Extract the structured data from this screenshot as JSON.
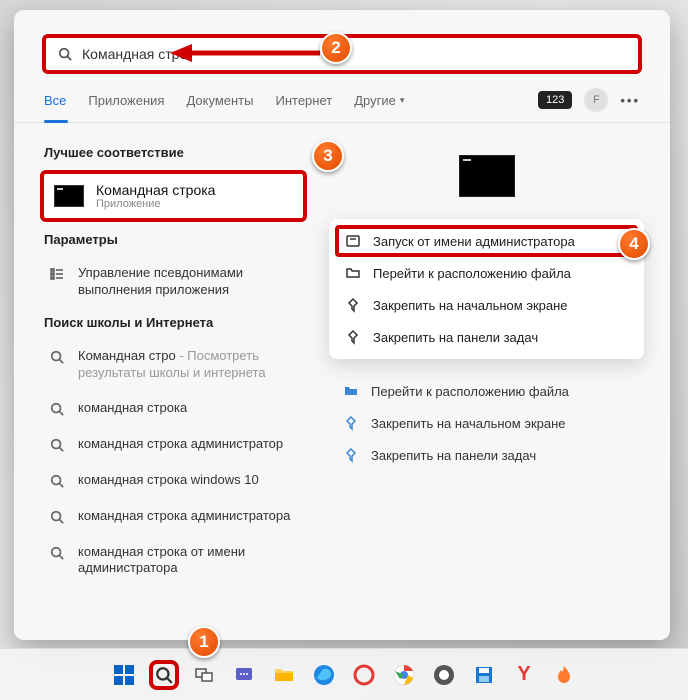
{
  "search": {
    "query": "Командная стро"
  },
  "tabs": {
    "all": "Все",
    "apps": "Приложения",
    "docs": "Документы",
    "internet": "Интернет",
    "other": "Другие",
    "badge": "123",
    "avatar": "F"
  },
  "headings": {
    "best": "Лучшее соответствие",
    "params": "Параметры",
    "school": "Поиск школы и Интернета"
  },
  "best": {
    "title": "Командная строка",
    "subtitle": "Приложение"
  },
  "params": {
    "aliases": "Управление псевдонимами выполнения приложения"
  },
  "school_rows": [
    {
      "main": "Командная стро",
      "extra": " - Посмотреть результаты школы и интернета"
    },
    {
      "main": "командная строка",
      "extra": ""
    },
    {
      "main": "командная строка администратор",
      "extra": ""
    },
    {
      "main": "командная строка windows 10",
      "extra": ""
    },
    {
      "main": "командная строка администратора",
      "extra": ""
    },
    {
      "main": "командная строка от имени администратора",
      "extra": ""
    }
  ],
  "context": {
    "run_admin": "Запуск от имени администратора",
    "open_loc": "Перейти к расположению файла",
    "pin_start": "Закрепить на начальном экране",
    "pin_task": "Закрепить на панели задач"
  },
  "links": {
    "open_loc": "Перейти к расположению файла",
    "pin_start": "Закрепить на начальном экране",
    "pin_task": "Закрепить на панели задач"
  },
  "markers": {
    "m1": "1",
    "m2": "2",
    "m3": "3",
    "m4": "4"
  }
}
